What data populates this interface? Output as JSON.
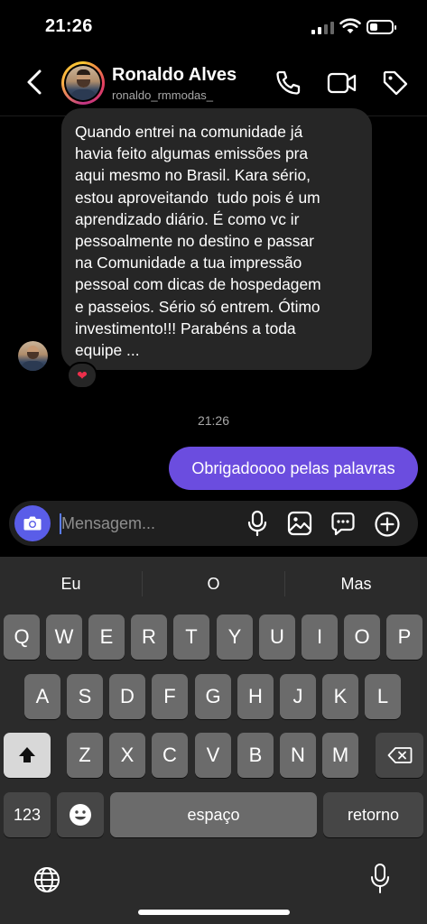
{
  "status_bar": {
    "time": "21:26"
  },
  "header": {
    "name": "Ronaldo Alves",
    "username": "ronaldo_rmmodas_",
    "icons": [
      "back-icon",
      "phone-icon",
      "video-icon",
      "tag-icon"
    ]
  },
  "messages": {
    "incoming": {
      "lines": [
        "Quando entrei na comunidade já",
        "havia feito algumas emissões pra",
        "aqui mesmo no Brasil. Kara sério,",
        "estou aproveitando  tudo pois é um",
        "aprendizado diário. É como vc ir",
        "pessoalmente no destino e passar",
        "na Comunidade a tua impressão",
        "pessoal com dicas de hospedagem",
        "e passeios. Sério só entrem. Ótimo",
        "investimento!!! Parabéns a toda",
        "equipe ..."
      ],
      "reaction": "❤"
    },
    "timestamp": "21:26",
    "outgoing": "Obrigadoooo pelas palavras"
  },
  "composer": {
    "placeholder": "Mensagem...",
    "icons": [
      "camera-icon",
      "microphone-icon",
      "gallery-icon",
      "sticker-icon",
      "plus-icon"
    ]
  },
  "keyboard": {
    "suggestions": [
      "Eu",
      "O",
      "Mas"
    ],
    "row1": [
      "Q",
      "W",
      "E",
      "R",
      "T",
      "Y",
      "U",
      "I",
      "O",
      "P"
    ],
    "row2": [
      "A",
      "S",
      "D",
      "F",
      "G",
      "H",
      "J",
      "K",
      "L"
    ],
    "row3": [
      "Z",
      "X",
      "C",
      "V",
      "B",
      "N",
      "M"
    ],
    "numbers_label": "123",
    "space_label": "espaço",
    "return_label": "retorno"
  }
}
